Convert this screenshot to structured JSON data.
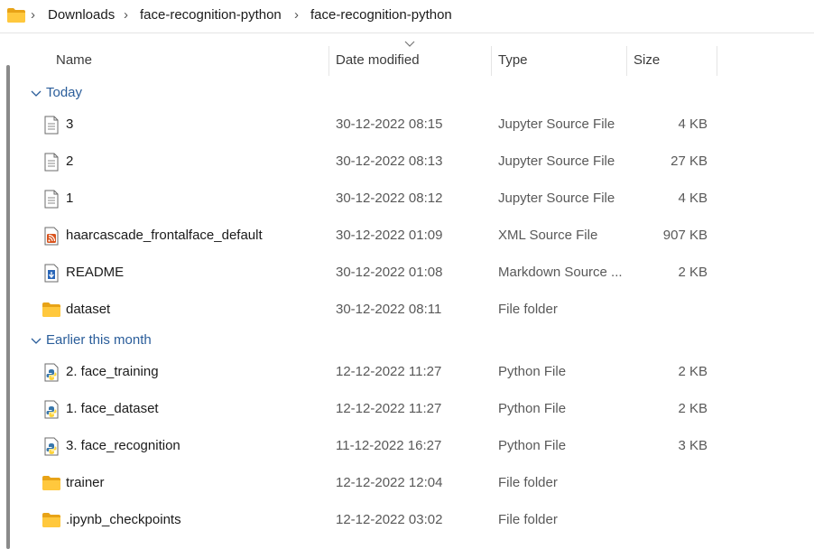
{
  "breadcrumb": {
    "icon": "folder-icon",
    "parts": [
      "Downloads",
      "face-recognition-python",
      "face-recognition-python"
    ],
    "separator": "›"
  },
  "columns": {
    "name": "Name",
    "date": "Date modified",
    "type": "Type",
    "size": "Size",
    "sorted_by": "Date modified"
  },
  "groups": [
    {
      "label": "Today",
      "rows": [
        {
          "icon": "text-file-icon",
          "name": "3",
          "date": "30-12-2022 08:15",
          "type": "Jupyter Source File",
          "size": "4 KB"
        },
        {
          "icon": "text-file-icon",
          "name": "2",
          "date": "30-12-2022 08:13",
          "type": "Jupyter Source File",
          "size": "27 KB"
        },
        {
          "icon": "text-file-icon",
          "name": "1",
          "date": "30-12-2022 08:12",
          "type": "Jupyter Source File",
          "size": "4 KB"
        },
        {
          "icon": "xml-file-icon",
          "name": "haarcascade_frontalface_default",
          "date": "30-12-2022 01:09",
          "type": "XML Source File",
          "size": "907 KB"
        },
        {
          "icon": "markdown-file-icon",
          "name": "README",
          "date": "30-12-2022 01:08",
          "type": "Markdown Source ...",
          "size": "2 KB"
        },
        {
          "icon": "folder-icon",
          "name": "dataset",
          "date": "30-12-2022 08:11",
          "type": "File folder",
          "size": ""
        }
      ]
    },
    {
      "label": "Earlier this month",
      "rows": [
        {
          "icon": "python-file-icon",
          "name": "2. face_training",
          "date": "12-12-2022 11:27",
          "type": "Python File",
          "size": "2 KB"
        },
        {
          "icon": "python-file-icon",
          "name": "1. face_dataset",
          "date": "12-12-2022 11:27",
          "type": "Python File",
          "size": "2 KB"
        },
        {
          "icon": "python-file-icon",
          "name": "3. face_recognition",
          "date": "11-12-2022 16:27",
          "type": "Python File",
          "size": "3 KB"
        },
        {
          "icon": "folder-icon",
          "name": "trainer",
          "date": "12-12-2022 12:04",
          "type": "File folder",
          "size": ""
        },
        {
          "icon": "folder-icon",
          "name": ".ipynb_checkpoints",
          "date": "12-12-2022 03:02",
          "type": "File folder",
          "size": ""
        }
      ]
    }
  ],
  "colors": {
    "group_label": "#2a5d9a",
    "folder": "#ffc83d",
    "folder_back": "#e8a317",
    "xml_icon": "#d9541e",
    "python_blue": "#3776ab",
    "python_yellow": "#ffd43b",
    "markdown_blue": "#2b67b8"
  }
}
